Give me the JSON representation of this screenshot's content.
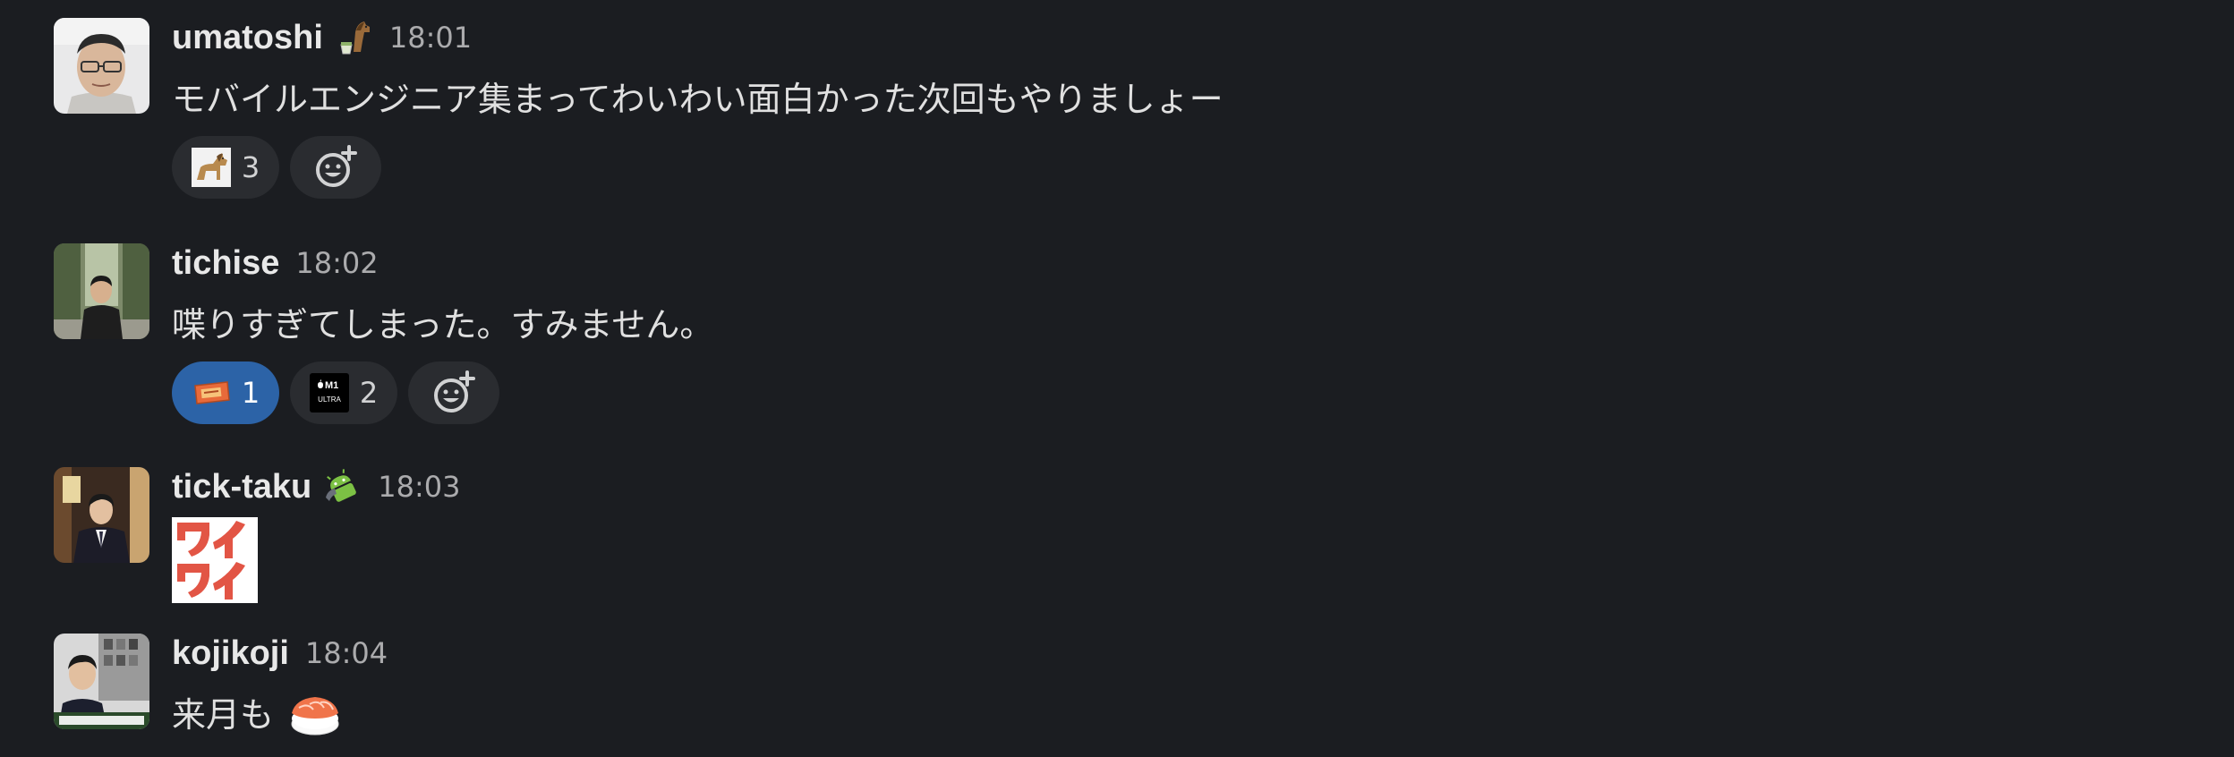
{
  "messages": [
    {
      "username": "umatoshi",
      "time": "18:01",
      "text": "モバイルエンジニア集まってわいわい面白かった次回もやりましょー",
      "status_icon": "horse-and-cup-icon",
      "reactions": [
        {
          "emoji": "horse-icon",
          "count": "3",
          "active": false
        }
      ]
    },
    {
      "username": "tichise",
      "time": "18:02",
      "text": "喋りすぎてしまった。すみません。",
      "reactions": [
        {
          "emoji": "ticket-icon",
          "count": "1",
          "active": true
        },
        {
          "emoji": "m1-ultra-chip-icon",
          "count": "2",
          "active": false
        }
      ]
    },
    {
      "username": "tick-taku",
      "time": "18:03",
      "status_icon": "android-icon",
      "custom_emoji": "ワイワイ"
    },
    {
      "username": "kojikoji",
      "time": "18:04",
      "text": "来月も",
      "inline_emoji": "sushi-icon"
    }
  ],
  "m1_chip_text": {
    "top": "M1",
    "bottom": "ULTRA"
  },
  "colors": {
    "background": "#1b1d21",
    "active_reaction": "#2c63a7",
    "custom_emoji_red": "#e25545"
  }
}
